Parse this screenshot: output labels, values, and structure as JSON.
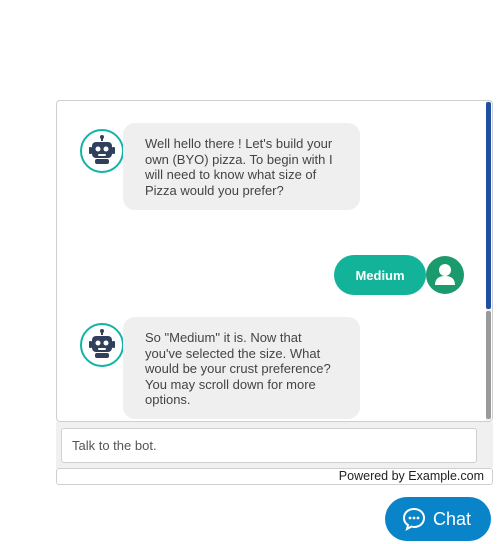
{
  "messages": [
    {
      "from": "bot",
      "text": "Well hello there ! Let's build your own (BYO) pizza. To begin with I will need to know what size of Pizza would you prefer?"
    },
    {
      "from": "user",
      "text": "Medium"
    },
    {
      "from": "bot",
      "text": "So \"Medium\" it is. Now that you've selected the size. What would be your crust preference? You may scroll down for more options."
    }
  ],
  "input": {
    "placeholder": "Talk to the bot."
  },
  "footer": {
    "powered_by": "Powered by Example.com"
  },
  "launcher": {
    "label": "Chat",
    "icon": "chat-bubble-icon"
  },
  "icons": {
    "bot_avatar": "robot-icon",
    "user_avatar": "user-icon"
  },
  "colors": {
    "bot_avatar_ring": "#12b3a6",
    "user_bubble": "#12b398",
    "user_avatar": "#1b9a6e",
    "launcher": "#0a84c8",
    "bot_bubble": "#efefef"
  }
}
